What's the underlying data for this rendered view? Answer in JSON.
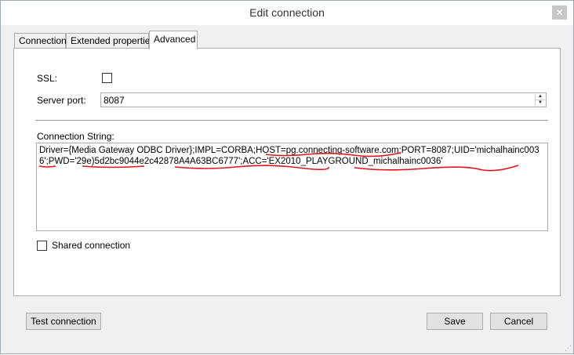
{
  "window": {
    "title": "Edit connection",
    "close_glyph": "✕"
  },
  "tabs": [
    {
      "label": "Connection",
      "active": false
    },
    {
      "label": "Extended properties",
      "active": false
    },
    {
      "label": "Advanced",
      "active": true
    }
  ],
  "advanced": {
    "ssl_label": "SSL:",
    "ssl_checked": false,
    "server_port_label": "Server port:",
    "server_port_value": "8087",
    "connection_string_label": "Connection String:",
    "connection_string_value": "Driver={Media Gateway ODBC Driver};IMPL=CORBA;HOST=pg.connecting-software.com;PORT=8087;UID='michalhainc0036';PWD='29e)5d2bc9044e2c42878A4A63BC6777';ACC='EX2010_PLAYGROUND_michalhainc0036'",
    "shared_connection_label": "Shared connection",
    "shared_connection_checked": false
  },
  "buttons": {
    "test_connection": "Test connection",
    "save": "Save",
    "cancel": "Cancel"
  },
  "colors": {
    "redaction_underline": "#e0141e"
  }
}
